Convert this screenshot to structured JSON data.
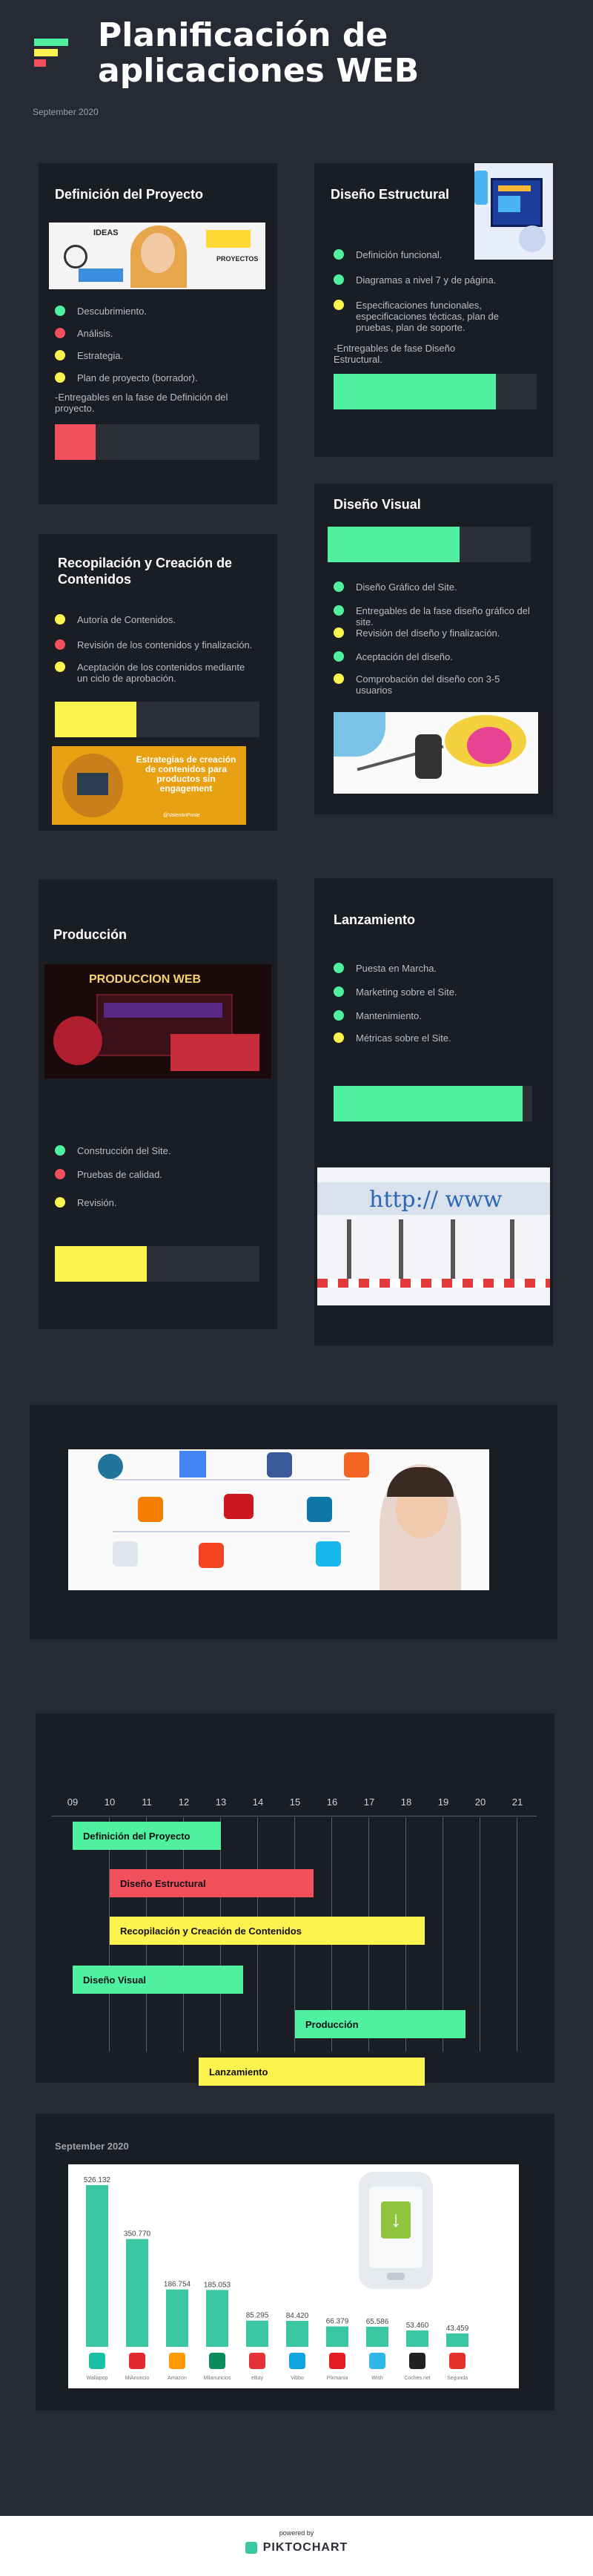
{
  "header": {
    "title_line1": "Planificación de",
    "title_line2": "aplicaciones WEB",
    "date": "September 2020"
  },
  "colors": {
    "green": "#4ff1a1",
    "red": "#f2505d",
    "yellow": "#fdf34f",
    "track": "#2c2f38"
  },
  "cards": {
    "definicion": {
      "title": "Definición del Proyecto",
      "image_words": [
        "IDEAS",
        "PROYECTOS"
      ],
      "bullets": [
        {
          "text": "Descubrimiento.",
          "color": "green"
        },
        {
          "text": "Análisis.",
          "color": "red"
        },
        {
          "text": "Estrategia.",
          "color": "yellow"
        },
        {
          "text": "Plan de proyecto (borrador).",
          "color": "yellow"
        }
      ],
      "note": "-Entregables en la fase de Definición del proyecto.",
      "progress": 0.2
    },
    "estructural": {
      "title": "Diseño Estructural",
      "bullets": [
        {
          "text": "Definición funcional.",
          "color": "green"
        },
        {
          "text": "Diagramas a nivel 7 y de página.",
          "color": "green"
        },
        {
          "text": "Especificaciones funcionales, especificaciones técticas, plan de pruebas, plan de soporte.",
          "color": "yellow"
        }
      ],
      "note": "-Entregables de fase Diseño Estructural.",
      "progress": 0.8
    },
    "visual": {
      "title": "Diseño Visual",
      "progress": 0.65,
      "bullets": [
        {
          "text": "Diseño Gráfico del Site.",
          "color": "green"
        },
        {
          "text": "Entregables de la fase diseño gráfico del site.",
          "color": "green"
        },
        {
          "text": "Revisión del diseño y finalización.",
          "color": "yellow"
        },
        {
          "text": "Aceptación del diseño.",
          "color": "green"
        },
        {
          "text": "Comprobación del diseño con 3-5 usuarios",
          "color": "yellow"
        }
      ]
    },
    "recopilacion": {
      "title": "Recopilación y Creación de Contenidos",
      "bullets": [
        {
          "text": "Autoría de Contenidos.",
          "color": "yellow"
        },
        {
          "text": "Revisión de los contenidos y finalización.",
          "color": "red"
        },
        {
          "text": "Aceptación de los contenidos mediante un ciclo de aprobación.",
          "color": "yellow"
        }
      ],
      "progress": 0.4,
      "image_text": "Estrategias de creación de contenidos para productos sin engagement",
      "image_handle": "@ValentinPoole"
    },
    "produccion": {
      "title": "Producción",
      "image_text": "PRODUCCION WEB",
      "bullets": [
        {
          "text": "Construcción del Site.",
          "color": "green"
        },
        {
          "text": "Pruebas de calidad.",
          "color": "red"
        },
        {
          "text": "Revisión.",
          "color": "yellow"
        }
      ],
      "progress": 0.45
    },
    "lanzamiento": {
      "title": "Lanzamiento",
      "bullets": [
        {
          "text": "Puesta en Marcha.",
          "color": "green"
        },
        {
          "text": "Marketing sobre el Site.",
          "color": "green"
        },
        {
          "text": "Mantenimiento.",
          "color": "green"
        },
        {
          "text": "Métricas sobre el Site.",
          "color": "yellow"
        }
      ],
      "progress": 0.95,
      "image_text": "http:// www"
    }
  },
  "gantt": {
    "hours": [
      "09",
      "10",
      "11",
      "12",
      "13",
      "14",
      "15",
      "16",
      "17",
      "18",
      "19",
      "20",
      "21"
    ],
    "tasks": [
      {
        "label": "Definición del Proyecto",
        "start": 9,
        "end": 13,
        "color": "green",
        "row": 0
      },
      {
        "label": "Diseño Estructural",
        "start": 10,
        "end": 15.5,
        "color": "red",
        "row": 1
      },
      {
        "label": "Recopilación y Creación de Contenidos",
        "start": 10,
        "end": 18.5,
        "color": "yellow",
        "row": 2
      },
      {
        "label": "Diseño Visual",
        "start": 9,
        "end": 13.6,
        "color": "green",
        "row": 3
      },
      {
        "label": "Producción",
        "start": 15,
        "end": 19.6,
        "color": "green",
        "row": 4
      },
      {
        "label": "Lanzamiento",
        "start": 12.4,
        "end": 18.5,
        "color": "yellow",
        "row": 5
      }
    ]
  },
  "chart_data": {
    "type": "bar",
    "title": "September 2020",
    "categories": [
      "Wallapop",
      "MiAnuncio",
      "Amazon",
      "Milanuncios",
      "eBay",
      "Vibbo",
      "Pixmania",
      "Wish",
      "Coches.net",
      "Segunda"
    ],
    "value_labels": [
      "526.132",
      "350.770",
      "186.754",
      "185.053",
      "85.295",
      "84.420",
      "66.379",
      "65.586",
      "53.460",
      "43.459"
    ],
    "values": [
      526132,
      350770,
      186754,
      185053,
      85295,
      84420,
      66379,
      65586,
      53460,
      43459
    ],
    "ylim": [
      0,
      560000
    ],
    "color": "#3bc7a1"
  },
  "footer": {
    "powered_by": "powered by",
    "brand": "PIKTOCHART"
  }
}
